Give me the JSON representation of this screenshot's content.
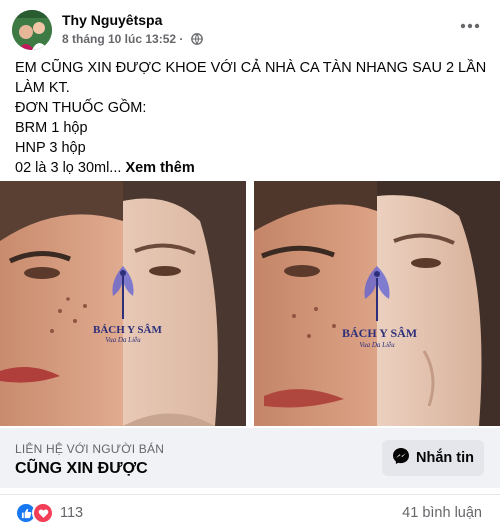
{
  "post": {
    "author": "Thy Nguyêtspa",
    "timestamp": "8 tháng 10 lúc 13:52 ·",
    "privacy_icon": "globe-icon",
    "text_lines": [
      "EM CŨNG XIN ĐƯỢC KHOE VỚI CẢ NHÀ CA TÀN NHANG SAU 2 LẦN",
      "LÀM KT.",
      "ĐƠN THUỐC GỒM:",
      "BRM 1 hộp",
      "HNP 3 hộp",
      "02 là 3 lọ 30ml..."
    ],
    "see_more": "Xem thêm"
  },
  "photos": [
    {
      "watermark_brand": "BÁCH Y SÂM",
      "watermark_tagline": "Vua Da Liễu"
    },
    {
      "watermark_brand": "BÁCH Y SÂM",
      "watermark_tagline": "Vua Da Liễu"
    }
  ],
  "cta": {
    "small_label": "LIÊN HỆ VỚI NGƯỜI BÁN",
    "title": "CŨNG XIN ĐƯỢC",
    "button_label": "Nhắn tin"
  },
  "footer": {
    "reaction_count": "113",
    "comments": "41 bình luận"
  },
  "colors": {
    "facebook_blue": "#1877f2",
    "love_red": "#f33e58",
    "secondary_text": "#65676b",
    "cta_bg": "#f0f2f5",
    "button_bg": "#e4e6eb"
  }
}
